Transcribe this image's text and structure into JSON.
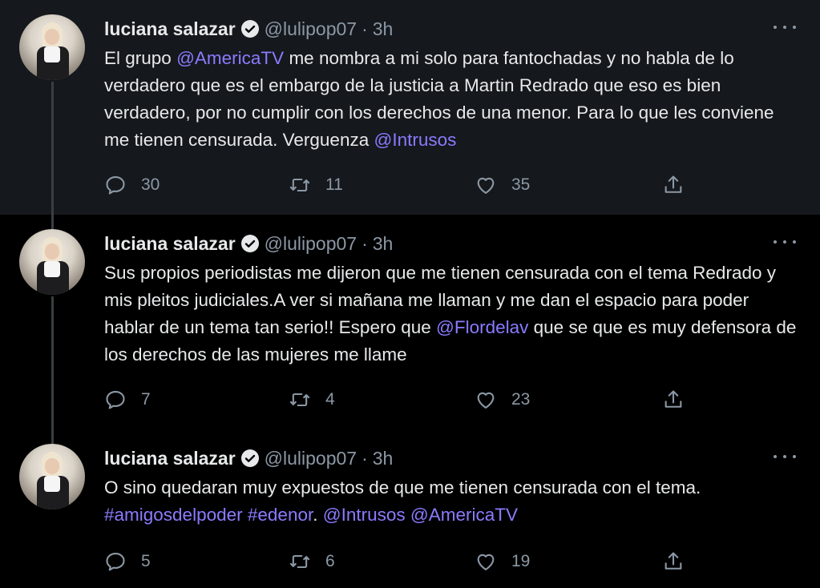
{
  "colors": {
    "link": "#8a7bff",
    "muted": "#8b98a5",
    "text": "#e7e9ea"
  },
  "tweets": [
    {
      "name": "luciana salazar",
      "handle": "@lulipop07",
      "sep": "·",
      "time": "3h",
      "text": [
        {
          "t": "El grupo "
        },
        {
          "t": "@AmericaTV",
          "link": true
        },
        {
          "t": " me nombra a mi solo para fantochadas y no habla de lo  verdadero que es el embargo de la justicia a Martin Redrado que eso es bien verdadero, por no cumplir con los derechos de una menor. Para lo que les conviene me tienen censurada. Verguenza "
        },
        {
          "t": "@Intrusos",
          "link": true
        }
      ],
      "replies": "30",
      "retweets": "11",
      "likes": "35"
    },
    {
      "name": "luciana salazar",
      "handle": "@lulipop07",
      "sep": "·",
      "time": "3h",
      "text": [
        {
          "t": "Sus propios periodistas me dijeron que me tienen censurada con el tema Redrado y mis pleitos judiciales.A ver si mañana me llaman y me dan el espacio para poder hablar de un tema tan serio!! Espero que "
        },
        {
          "t": "@Flordelav",
          "link": true
        },
        {
          "t": " que se que es muy defensora de los derechos de las mujeres me llame"
        }
      ],
      "replies": "7",
      "retweets": "4",
      "likes": "23"
    },
    {
      "name": "luciana salazar",
      "handle": "@lulipop07",
      "sep": "·",
      "time": "3h",
      "text": [
        {
          "t": "O sino quedaran muy expuestos de que me tienen censurada con el tema. "
        },
        {
          "t": "#amigosdelpoder",
          "link": true
        },
        {
          "t": " "
        },
        {
          "t": "#edenor",
          "link": true
        },
        {
          "t": ". "
        },
        {
          "t": "@Intrusos",
          "link": true
        },
        {
          "t": " "
        },
        {
          "t": "@AmericaTV",
          "link": true
        }
      ],
      "replies": "5",
      "retweets": "6",
      "likes": "19"
    }
  ]
}
